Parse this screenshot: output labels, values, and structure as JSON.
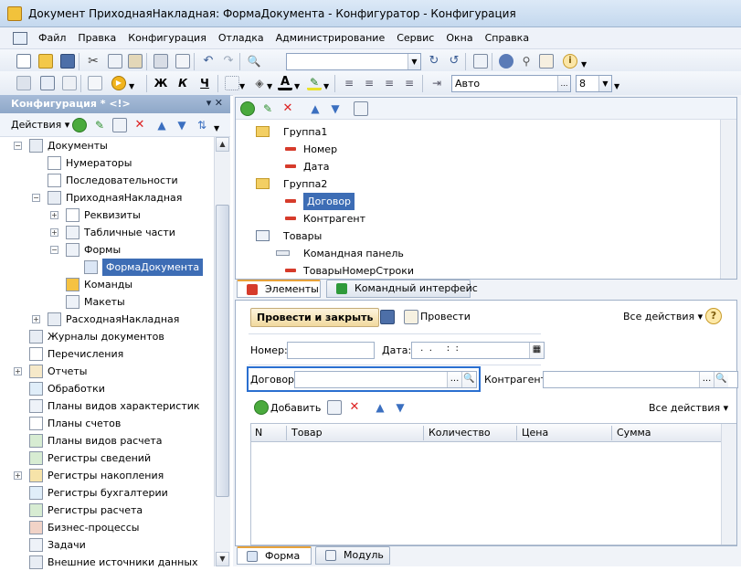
{
  "window": {
    "title": "Документ ПриходнаяНакладная: ФормаДокумента - Конфигуратор - Конфигурация"
  },
  "menu": [
    "Файл",
    "Правка",
    "Конфигурация",
    "Отладка",
    "Администрирование",
    "Сервис",
    "Окна",
    "Справка"
  ],
  "toolbar": {
    "search_value": "",
    "bold_label": "Ж",
    "italic_label": "К",
    "underline_label": "Ч",
    "font_name": "Авто",
    "font_size": "8"
  },
  "config_panel": {
    "title": "Конфигурация * <!>",
    "header_buttons": "▾ ✕",
    "actions_label": "Действия ▾",
    "tree": [
      {
        "label": "Документы",
        "level": 0,
        "expander": "−",
        "icon": "documents-icon"
      },
      {
        "label": "Нумераторы",
        "level": 1,
        "expander": "",
        "icon": "numerators-icon"
      },
      {
        "label": "Последовательности",
        "level": 1,
        "expander": "",
        "icon": "sequences-icon"
      },
      {
        "label": "ПриходнаяНакладная",
        "level": 1,
        "expander": "−",
        "icon": "document-icon"
      },
      {
        "label": "Реквизиты",
        "level": 2,
        "expander": "+",
        "icon": "attributes-icon"
      },
      {
        "label": "Табличные части",
        "level": 2,
        "expander": "+",
        "icon": "tabular-icon"
      },
      {
        "label": "Формы",
        "level": 2,
        "expander": "−",
        "icon": "forms-icon"
      },
      {
        "label": "ФормаДокумента",
        "level": 3,
        "expander": "",
        "icon": "form-icon",
        "selected": true
      },
      {
        "label": "Команды",
        "level": 2,
        "expander": "",
        "icon": "commands-icon"
      },
      {
        "label": "Макеты",
        "level": 2,
        "expander": "",
        "icon": "templates-icon"
      },
      {
        "label": "РасходнаяНакладная",
        "level": 1,
        "expander": "+",
        "icon": "document-icon"
      },
      {
        "label": "Журналы документов",
        "level": 0,
        "expander": "",
        "icon": "journals-icon"
      },
      {
        "label": "Перечисления",
        "level": 0,
        "expander": "",
        "icon": "enums-icon"
      },
      {
        "label": "Отчеты",
        "level": 0,
        "expander": "+",
        "icon": "reports-icon"
      },
      {
        "label": "Обработки",
        "level": 0,
        "expander": "",
        "icon": "processing-icon"
      },
      {
        "label": "Планы видов характеристик",
        "level": 0,
        "expander": "",
        "icon": "chart-types-icon"
      },
      {
        "label": "Планы счетов",
        "level": 0,
        "expander": "",
        "icon": "accounts-icon"
      },
      {
        "label": "Планы видов расчета",
        "level": 0,
        "expander": "",
        "icon": "calc-types-icon"
      },
      {
        "label": "Регистры сведений",
        "level": 0,
        "expander": "",
        "icon": "info-registers-icon"
      },
      {
        "label": "Регистры накопления",
        "level": 0,
        "expander": "+",
        "icon": "accum-registers-icon"
      },
      {
        "label": "Регистры бухгалтерии",
        "level": 0,
        "expander": "",
        "icon": "acc-registers-icon"
      },
      {
        "label": "Регистры расчета",
        "level": 0,
        "expander": "",
        "icon": "calc-registers-icon"
      },
      {
        "label": "Бизнес-процессы",
        "level": 0,
        "expander": "",
        "icon": "business-processes-icon"
      },
      {
        "label": "Задачи",
        "level": 0,
        "expander": "",
        "icon": "tasks-icon"
      },
      {
        "label": "Внешние источники данных",
        "level": 0,
        "expander": "",
        "icon": "external-sources-icon"
      }
    ]
  },
  "elements_tree": [
    {
      "label": "Группа1",
      "level": 0,
      "icon": "folder-icon"
    },
    {
      "label": "Номер",
      "level": 1,
      "icon": "field-icon"
    },
    {
      "label": "Дата",
      "level": 1,
      "icon": "field-icon"
    },
    {
      "label": "Группа2",
      "level": 0,
      "icon": "folder-icon"
    },
    {
      "label": "Договор",
      "level": 1,
      "icon": "field-icon",
      "selected": true
    },
    {
      "label": "Контрагент",
      "level": 1,
      "icon": "field-icon"
    },
    {
      "label": "Товары",
      "level": 0,
      "icon": "table-icon"
    },
    {
      "label": "Командная панель",
      "level": 1,
      "icon": "command-bar-icon"
    },
    {
      "label": "ТоварыНомерСтроки",
      "level": 1,
      "icon": "field-icon"
    }
  ],
  "top_tabs": [
    "Элементы",
    "Командный интерфейс"
  ],
  "form": {
    "post_close_label": "Провести и закрыть",
    "post_label": "Провести",
    "all_actions_label": "Все действия ▾",
    "help_label": "?",
    "number_label": "Номер:",
    "number_value": "",
    "date_label": "Дата:",
    "date_value": " .  .     :  :",
    "contract_label": "Договор:",
    "contract_value": "",
    "counterparty_label": "Контрагент:",
    "counterparty_value": "",
    "add_label": "Добавить",
    "table_all_actions_label": "Все действия ▾",
    "columns": [
      "N",
      "Товар",
      "Количество",
      "Цена",
      "Сумма"
    ],
    "dots": "...",
    "search_glyph": "🔍"
  },
  "bottom_tabs": [
    "Форма",
    "Модуль"
  ],
  "colors": {
    "selection": "#3d6db5",
    "tab_accent": "#e8a23a",
    "panel_header": "#8ea7c8"
  }
}
